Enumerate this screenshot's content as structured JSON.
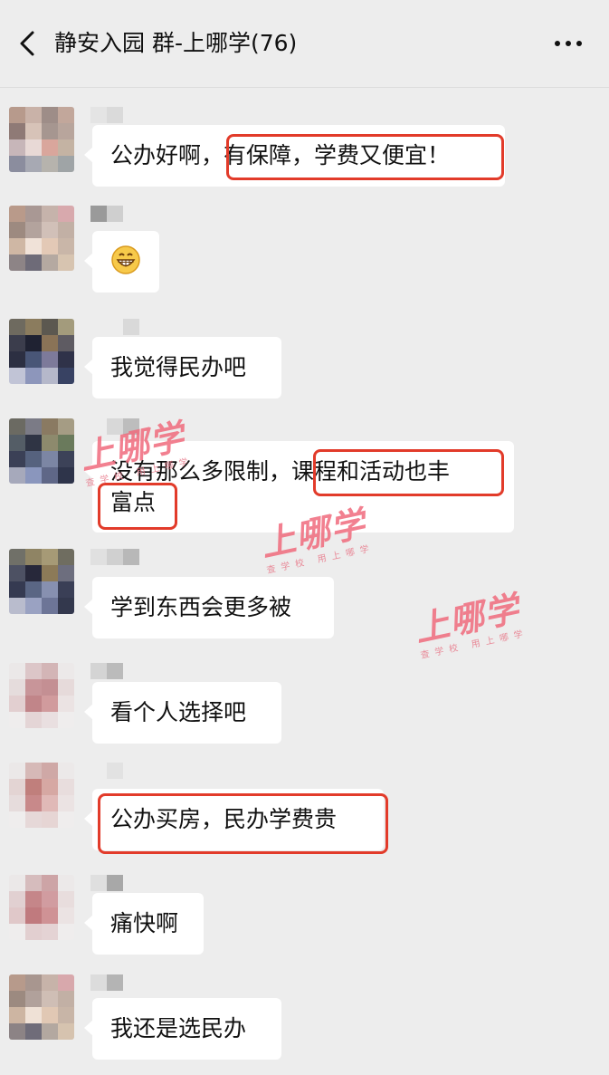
{
  "header": {
    "title": "静安入园 群-上哪学(76)"
  },
  "messages": [
    {
      "text": "公办好啊，有保障，学费又便宜！"
    },
    {
      "emoji": "😁"
    },
    {
      "text": "我觉得民办吧"
    },
    {
      "line1": "没有那么多限制，课程和活动也丰",
      "line2": "富点"
    },
    {
      "text": "学到东西会更多被"
    },
    {
      "text": "看个人选择吧"
    },
    {
      "text": "公办买房，民办学费贵"
    },
    {
      "text": "痛快啊"
    },
    {
      "text": "我还是选民办"
    }
  ],
  "watermark": {
    "brand": "上哪学",
    "tagline": "查学校 用上哪学"
  },
  "colors": {
    "background": "#ededed",
    "bubble": "#ffffff",
    "highlight": "#e23b2a",
    "watermark": "#f06b7d"
  }
}
